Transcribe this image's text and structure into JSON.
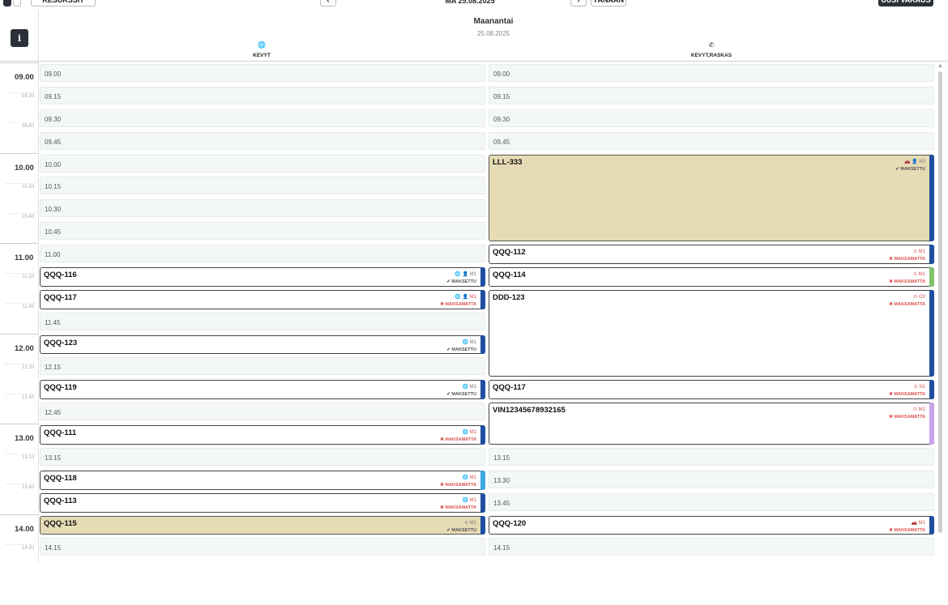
{
  "toolbar": {
    "resources_label": "RESURSSIT",
    "date_label": "MA 25.08.2025",
    "today_label": "TÄNÄÄN",
    "new_booking_label": "UUSI VARAUS",
    "prev_icon": "chevron-left-icon",
    "next_icon": "chevron-right-icon"
  },
  "header": {
    "info_label": "i",
    "day": "Maanantai",
    "date": "25.08.2025",
    "columns": [
      {
        "icon": "globe-icon",
        "glyph": "🌐",
        "name": "KEVYT"
      },
      {
        "icon": "phone-icon",
        "glyph": "✆",
        "name": "KEVYT,RASKAS"
      }
    ]
  },
  "times": {
    "hours": [
      "09.00",
      "10.00",
      "11.00",
      "12.00",
      "13.00",
      "14.00"
    ],
    "minor": [
      "09.20",
      "09.40",
      "10.20",
      "10.40",
      "11.20",
      "11.40",
      "12.20",
      "12.40",
      "13.20",
      "13.40",
      "14.20"
    ]
  },
  "slots_left": [
    "09.00",
    "09.15",
    "09.30",
    "09.45",
    "10.00",
    "10.15",
    "10.30",
    "10.45",
    "11.00",
    "11.45",
    "12.15",
    "12.45",
    "13.15",
    "14.15"
  ],
  "slots_right": [
    "09.00",
    "09.15",
    "09.30",
    "09.45",
    "13.15",
    "13.30",
    "13.45",
    "14.15"
  ],
  "bookings_left": [
    {
      "plate": "QQQ-116",
      "meta": "🌐 👤 M1",
      "paid": "✔ MAKSETTU"
    },
    {
      "plate": "QQQ-117",
      "meta": "🌐 👤 M1",
      "paid": "✖ MAKSAMATTA"
    },
    {
      "plate": "QQQ-123",
      "meta": "🌐 M1",
      "paid": "✔ MAKSETTU"
    },
    {
      "plate": "QQQ-119",
      "meta": "🌐 M1",
      "paid": "✔ MAKSETTU"
    },
    {
      "plate": "QQQ-111",
      "meta": "🌐 M1",
      "paid": "✖ MAKSAMATTA"
    },
    {
      "plate": "QQQ-118",
      "meta": "🌐 M1",
      "paid": "✖ MAKSAMATTA"
    },
    {
      "plate": "QQQ-113",
      "meta": "🌐 M1",
      "paid": "✖ MAKSAMATTA"
    },
    {
      "plate": "QQQ-115",
      "meta": "⊙ M1",
      "paid": "✔ MAKSETTU"
    }
  ],
  "bookings_right": [
    {
      "plate": "LLL-333",
      "meta": "🚗 👤 N3",
      "paid": "✔ MAKSETTU"
    },
    {
      "plate": "QQQ-112",
      "meta": "⊙ M1",
      "paid": "✖ MAKSAMATTA"
    },
    {
      "plate": "QQQ-114",
      "meta": "⊙ M1",
      "paid": "✖ MAKSAMATTA"
    },
    {
      "plate": "DDD-123",
      "meta": "⊙ O3",
      "paid": "✖ MAKSAMATTA"
    },
    {
      "plate": "QQQ-117",
      "meta": "⊙ N1",
      "paid": "✖ MAKSAMATTA"
    },
    {
      "plate": "VIN12345678932165",
      "meta": "⊙ M1",
      "paid": "✖ MAKSAMATTA"
    },
    {
      "plate": "QQQ-120",
      "meta": "🚗 M1",
      "paid": "✖ MAKSAMATTA"
    }
  ],
  "colors": {
    "blue": "#1f4fa0",
    "green": "#7fc36a",
    "purple": "#c9a3e8",
    "lightblue": "#3fa9e6",
    "paid_red": "#d9534f"
  }
}
